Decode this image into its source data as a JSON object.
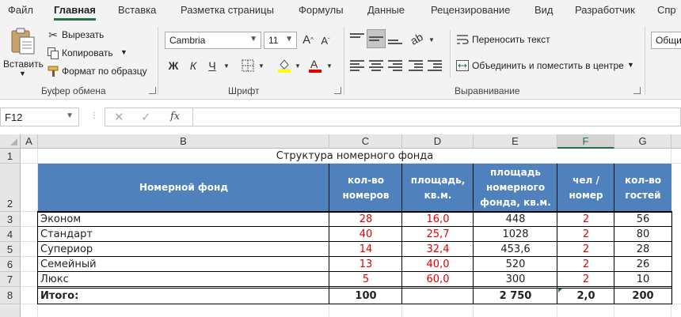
{
  "menu": {
    "tabs": [
      "Файл",
      "Главная",
      "Вставка",
      "Разметка страницы",
      "Формулы",
      "Данные",
      "Рецензирование",
      "Вид",
      "Разработчик",
      "Спр"
    ],
    "active_tab": "Главная"
  },
  "ribbon": {
    "clipboard": {
      "paste_label": "Вставить",
      "cut_label": "Вырезать",
      "copy_label": "Копировать",
      "format_painter_label": "Формат по образцу",
      "group_label": "Буфер обмена"
    },
    "font": {
      "font_name": "Cambria",
      "font_size": "11",
      "bold_label": "Ж",
      "italic_label": "К",
      "underline_label": "Ч",
      "group_label": "Шрифт"
    },
    "alignment": {
      "wrap_text_label": "Переносить текст",
      "merge_center_label": "Объединить и поместить в центре",
      "group_label": "Выравнивание"
    },
    "number": {
      "format_value": "Общи"
    }
  },
  "formula_bar": {
    "name_box": "F12",
    "formula": ""
  },
  "columns": [
    "A",
    "B",
    "C",
    "D",
    "E",
    "F",
    "G"
  ],
  "selected_column": "F",
  "rows": [
    "1",
    "2",
    "3",
    "4",
    "5",
    "6",
    "7",
    "8"
  ],
  "sheet": {
    "title": "Структура номерного фонда",
    "headers": {
      "fund": "Номерной фонд",
      "rooms": "кол-во номеров",
      "area": "площадь, кв.м.",
      "total_area": "площадь номерного фонда, кв.м.",
      "per_room": "чел / номер",
      "guests": "кол-во гостей"
    },
    "data": [
      {
        "name": "Эконом",
        "rooms": "28",
        "area": "16,0",
        "total_area": "448",
        "per_room": "2",
        "guests": "56"
      },
      {
        "name": "Стандарт",
        "rooms": "40",
        "area": "25,7",
        "total_area": "1028",
        "per_room": "2",
        "guests": "80"
      },
      {
        "name": "Супериор",
        "rooms": "14",
        "area": "32,4",
        "total_area": "453,6",
        "per_room": "2",
        "guests": "28"
      },
      {
        "name": "Семейный",
        "rooms": "13",
        "area": "40,0",
        "total_area": "520",
        "per_room": "2",
        "guests": "26"
      },
      {
        "name": "Люкс",
        "rooms": "5",
        "area": "60,0",
        "total_area": "300",
        "per_room": "2",
        "guests": "10"
      }
    ],
    "total": {
      "label": "Итого:",
      "rooms": "100",
      "total_area": "2 750",
      "per_room": "2,0",
      "guests": "200"
    }
  },
  "colors": {
    "accent": "#217346",
    "header_fill": "#4f81bd",
    "input_red": "#e00000"
  }
}
